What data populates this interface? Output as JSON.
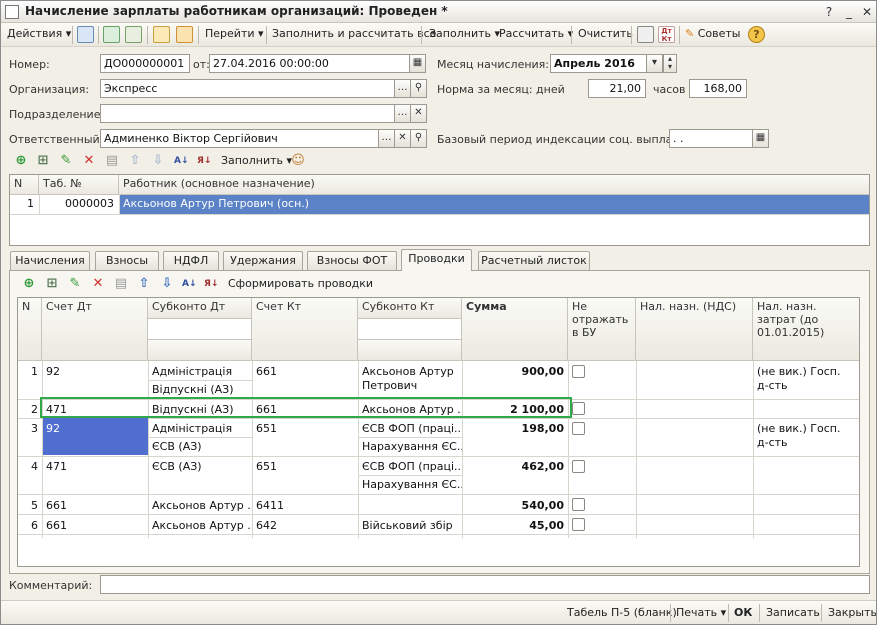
{
  "window": {
    "title": "Начисление зарплаты работникам организаций: Проведен *"
  },
  "toolbar": {
    "actions": "Действия",
    "goto": "Перейти",
    "fill_and_calc": "Заполнить и рассчитать все",
    "fill": "Заполнить",
    "calc": "Рассчитать",
    "clear": "Очистить",
    "tips": "Советы",
    "dt_kt": "Дт Кт"
  },
  "form": {
    "number_label": "Номер:",
    "number_value": "ДО000000001",
    "date_label": "от:",
    "date_value": "27.04.2016 00:00:00",
    "month_label": "Месяц начисления:",
    "month_value": "Апрель 2016",
    "org_label": "Организация:",
    "org_value": "Экспресс",
    "norm_label": "Норма за месяц: дней",
    "norm_days": "21,00",
    "hours_label": "часов",
    "norm_hours": "168,00",
    "dept_label": "Подразделение:",
    "dept_value": "",
    "resp_label": "Ответственный:",
    "resp_value": "Админенко Віктор Сергійович",
    "base_label": "Базовый период индексации соц. выплат:",
    "base_value": ". ."
  },
  "workers": {
    "fill_label": "Заполнить",
    "headers": [
      "N",
      "Таб. №",
      "Работник (основное назначение)"
    ],
    "rows": [
      {
        "n": "1",
        "tab": "0000003",
        "name": "Аксьонов Артур Петрович (осн.)"
      }
    ]
  },
  "tabs": [
    "Начисления",
    "Взносы",
    "НДФЛ",
    "Удержания",
    "Взносы ФОТ",
    "Проводки",
    "Расчетный листок"
  ],
  "entries": {
    "form_button": "Сформировать проводки",
    "headers": {
      "n": "N",
      "dt": "Счет Дт",
      "sub_dt": "Субконто Дт",
      "kt": "Счет Кт",
      "sub_kt": "Субконто Кт",
      "sum": "Сумма",
      "no_bu": "Не отражать в БУ",
      "vat": "Нал. назн. (НДС)",
      "cost": "Нал. назн. затрат (до 01.01.2015)"
    },
    "rows": [
      {
        "n": "1",
        "dt": "92",
        "sub_dt1": "Адміністрація",
        "sub_dt2": "Відпускні (АЗ)",
        "kt": "661",
        "sub_kt1": "Аксьонов Артур",
        "sub_kt2": "Петрович",
        "sum": "900,00",
        "cost1": "(не вик.) Госп.",
        "cost2": "д-сть"
      },
      {
        "n": "2",
        "dt": "471",
        "sub_dt1": "Відпускні (АЗ)",
        "sub_dt2": "",
        "kt": "661",
        "sub_kt1": "Аксьонов Артур ...",
        "sub_kt2": "",
        "sum": "2 100,00",
        "cost1": "",
        "cost2": ""
      },
      {
        "n": "3",
        "dt": "92",
        "sub_dt1": "Адміністрація",
        "sub_dt2": "ЄСВ (АЗ)",
        "kt": "651",
        "sub_kt1": "ЄСВ ФОП (праці...",
        "sub_kt2": "Нарахування ЄС...",
        "sum": "198,00",
        "cost1": "(не вик.) Госп.",
        "cost2": "д-сть"
      },
      {
        "n": "4",
        "dt": "471",
        "sub_dt1": "ЄСВ (АЗ)",
        "sub_dt2": "",
        "kt": "651",
        "sub_kt1": "ЄСВ ФОП (праці...",
        "sub_kt2": "Нарахування ЄС...",
        "sum": "462,00",
        "cost1": "",
        "cost2": ""
      },
      {
        "n": "5",
        "dt": "661",
        "sub_dt1": "Аксьонов Артур ...",
        "sub_dt2": "",
        "kt": "6411",
        "sub_kt1": "",
        "sub_kt2": "",
        "sum": "540,00",
        "cost1": "",
        "cost2": ""
      },
      {
        "n": "6",
        "dt": "661",
        "sub_dt1": "Аксьонов Артур ...",
        "sub_dt2": "",
        "kt": "642",
        "sub_kt1": "Військовий збір",
        "sub_kt2": "",
        "sum": "45,00",
        "cost1": "",
        "cost2": ""
      }
    ]
  },
  "comment": {
    "label": "Комментарий:",
    "value": ""
  },
  "statusbar": {
    "t5": "Табель П-5 (бланк)",
    "print": "Печать",
    "ok": "ОК",
    "save": "Записать",
    "close": "Закрыть"
  },
  "colors": {
    "selection": "#5b82c6",
    "cell_selection": "#4f6ecf",
    "highlight_frame": "#2ea84a"
  }
}
